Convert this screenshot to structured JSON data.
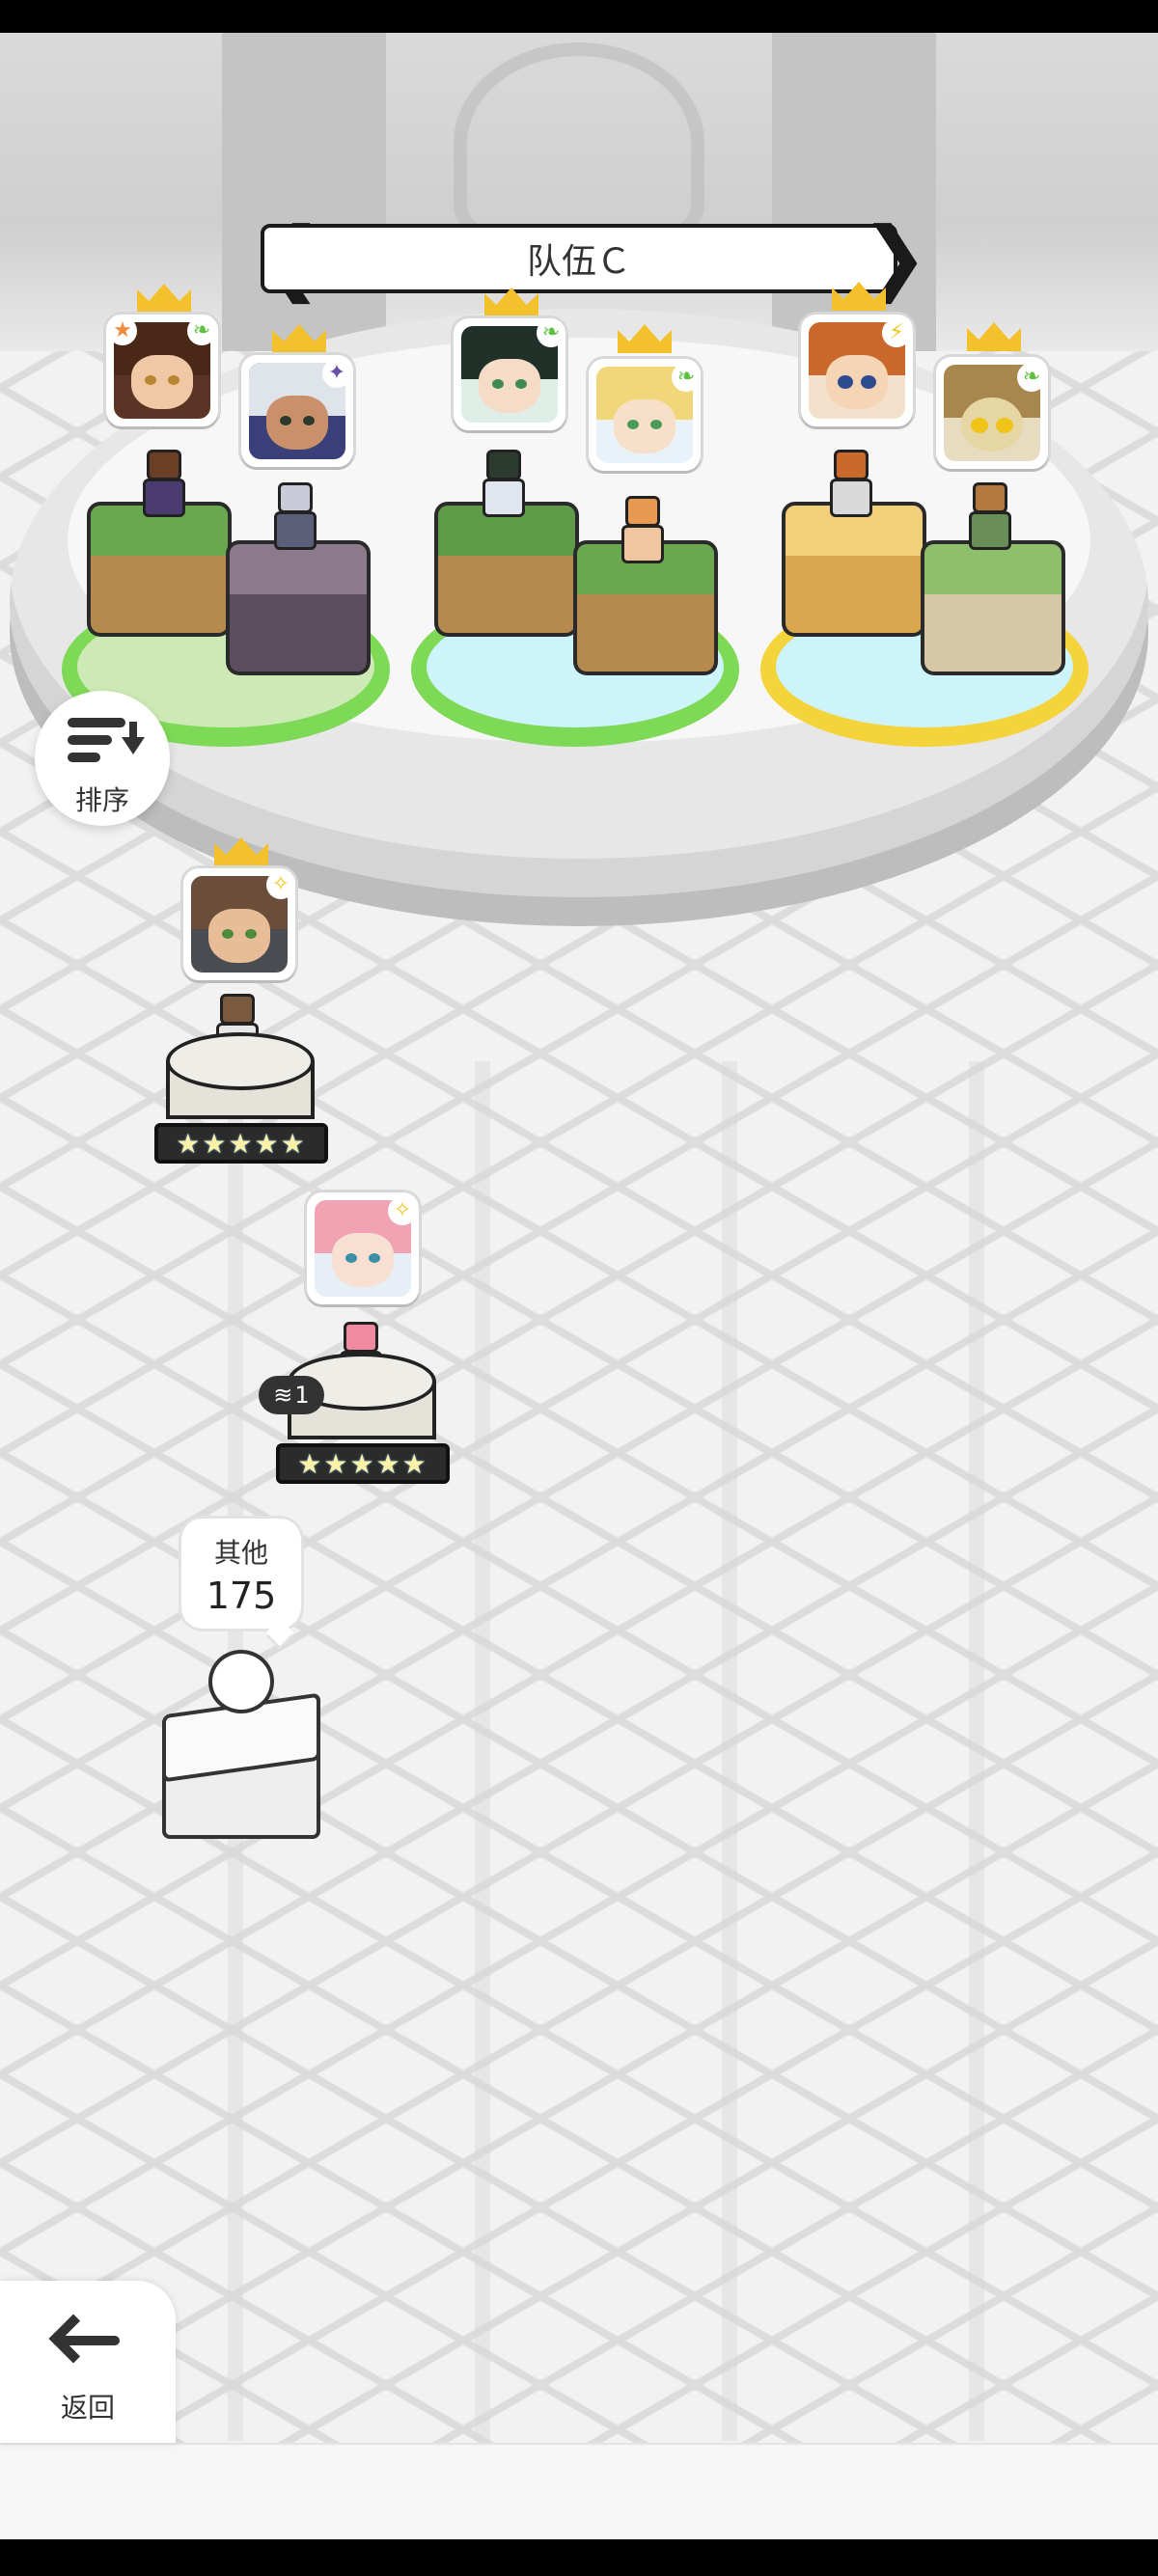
{
  "team": {
    "name": "队伍Ｃ"
  },
  "sort_button": {
    "label": "排序",
    "icon": "sort-icon"
  },
  "back_button": {
    "label": "返回",
    "icon": "back-arrow-icon"
  },
  "others": {
    "label": "其他",
    "count": "175"
  },
  "bench": {
    "hero1": {
      "stars": "★★★★★"
    },
    "hero2": {
      "stars": "★★★★★",
      "dupes": "1"
    }
  },
  "colors": {
    "crown": "#f3c12b",
    "pad_green": "#7ed957",
    "pad_blue": "#cdf3fb",
    "pad_yellow": "#f5d33b",
    "element_earth": "#5fbf3f",
    "element_dark": "#6b4ba8",
    "element_light": "#f0c419"
  }
}
